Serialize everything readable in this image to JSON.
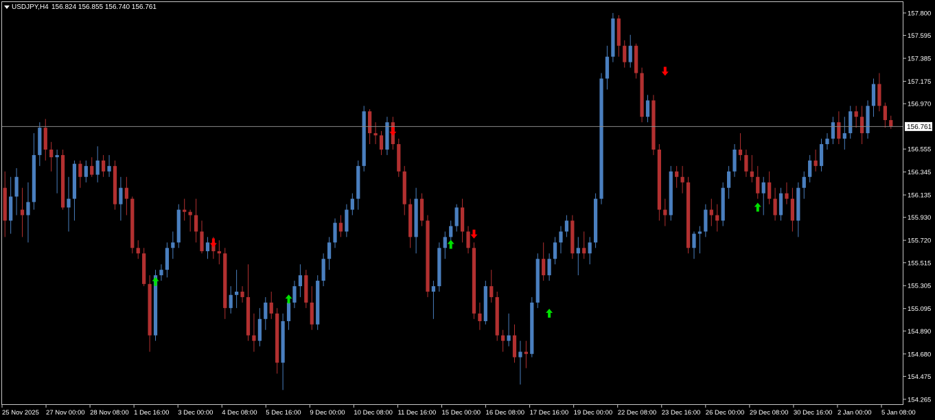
{
  "header": {
    "symbol": "USDJPY,H4",
    "ohlc": "156.824 156.855 156.740 156.761"
  },
  "colors": {
    "background": "#000000",
    "frame": "#c8c8c8",
    "text": "#ffffff",
    "bull": "#4a7fbf",
    "bear": "#b23030",
    "buy_arrow": "#00e000",
    "sell_arrow": "#ff0000",
    "current_price_line": "#8a8a8a",
    "price_label_bg": "#ffffff",
    "price_label_text": "#000000"
  },
  "chart_data": {
    "type": "candlestick",
    "symbol": "USDJPY",
    "timeframe": "H4",
    "ylim": [
      154.22,
      157.9
    ],
    "current_price": "156.761",
    "y_ticks": [
      "157.800",
      "157.595",
      "157.385",
      "157.175",
      "156.970",
      "156.555",
      "156.345",
      "156.135",
      "155.930",
      "155.720",
      "155.515",
      "155.305",
      "155.095",
      "154.890",
      "154.680",
      "154.475",
      "154.265"
    ],
    "x_ticks": [
      "25 Nov 2025",
      "27 Nov 00:00",
      "28 Nov 08:00",
      "1 Dec 16:00",
      "3 Dec 00:00",
      "4 Dec 08:00",
      "5 Dec 16:00",
      "9 Dec 00:00",
      "10 Dec 08:00",
      "11 Dec 16:00",
      "15 Dec 00:00",
      "16 Dec 08:00",
      "17 Dec 16:00",
      "19 Dec 00:00",
      "22 Dec 08:00",
      "23 Dec 16:00",
      "26 Dec 00:00",
      "29 Dec 08:00",
      "30 Dec 16:00",
      "2 Jan 00:00",
      "5 Jan 08:00"
    ],
    "candles": [
      [
        156.2,
        156.35,
        155.75,
        155.9
      ],
      [
        155.9,
        156.3,
        155.78,
        156.12
      ],
      [
        156.12,
        156.38,
        155.95,
        156.3
      ],
      [
        156.0,
        156.2,
        155.75,
        155.95
      ],
      [
        155.95,
        156.25,
        155.7,
        156.07
      ],
      [
        156.07,
        156.7,
        156.0,
        156.5
      ],
      [
        156.5,
        156.8,
        156.4,
        156.75
      ],
      [
        156.75,
        156.83,
        156.45,
        156.55
      ],
      [
        156.55,
        156.62,
        156.35,
        156.48
      ],
      [
        156.48,
        156.55,
        156.15,
        156.5
      ],
      [
        156.5,
        156.55,
        156.0,
        156.02
      ],
      [
        156.02,
        156.3,
        155.8,
        156.1
      ],
      [
        156.1,
        156.45,
        155.9,
        156.42
      ],
      [
        156.42,
        156.45,
        156.2,
        156.3
      ],
      [
        156.3,
        156.45,
        156.25,
        156.4
      ],
      [
        156.4,
        156.48,
        156.3,
        156.32
      ],
      [
        156.32,
        156.58,
        156.25,
        156.45
      ],
      [
        156.45,
        156.5,
        156.3,
        156.35
      ],
      [
        156.35,
        156.5,
        156.3,
        156.4
      ],
      [
        156.4,
        156.45,
        156.0,
        156.05
      ],
      [
        156.05,
        156.3,
        155.9,
        156.2
      ],
      [
        156.2,
        156.3,
        155.95,
        156.1
      ],
      [
        156.1,
        156.12,
        155.6,
        155.65
      ],
      [
        155.65,
        155.72,
        155.55,
        155.6
      ],
      [
        155.6,
        155.65,
        155.3,
        155.32
      ],
      [
        155.32,
        155.4,
        154.7,
        154.85
      ],
      [
        154.85,
        155.45,
        154.8,
        155.4
      ],
      [
        155.4,
        155.5,
        155.35,
        155.45
      ],
      [
        155.45,
        155.7,
        155.38,
        155.65
      ],
      [
        155.65,
        155.8,
        155.55,
        155.7
      ],
      [
        155.7,
        156.05,
        155.65,
        156.0
      ],
      [
        156.0,
        156.1,
        155.9,
        155.98
      ],
      [
        155.98,
        156.0,
        155.8,
        155.95
      ],
      [
        155.95,
        156.1,
        155.7,
        155.8
      ],
      [
        155.8,
        155.9,
        155.6,
        155.62
      ],
      [
        155.62,
        155.75,
        155.55,
        155.7
      ],
      [
        155.7,
        155.75,
        155.55,
        155.62
      ],
      [
        155.62,
        155.72,
        155.5,
        155.6
      ],
      [
        155.6,
        155.65,
        155.0,
        155.1
      ],
      [
        155.1,
        155.3,
        155.05,
        155.22
      ],
      [
        155.22,
        155.45,
        155.1,
        155.25
      ],
      [
        155.25,
        155.3,
        155.15,
        155.2
      ],
      [
        155.2,
        155.5,
        154.8,
        154.85
      ],
      [
        154.85,
        155.05,
        154.7,
        154.8
      ],
      [
        154.8,
        155.1,
        154.75,
        155.0
      ],
      [
        155.0,
        155.2,
        154.9,
        155.15
      ],
      [
        155.15,
        155.25,
        155.0,
        155.05
      ],
      [
        155.05,
        155.1,
        154.5,
        154.6
      ],
      [
        154.6,
        155.05,
        154.35,
        154.98
      ],
      [
        154.98,
        155.2,
        154.9,
        155.15
      ],
      [
        155.15,
        155.35,
        155.1,
        155.3
      ],
      [
        155.3,
        155.5,
        155.2,
        155.4
      ],
      [
        155.4,
        155.45,
        155.1,
        155.15
      ],
      [
        155.15,
        155.3,
        154.9,
        154.95
      ],
      [
        154.95,
        155.4,
        154.9,
        155.35
      ],
      [
        155.35,
        155.6,
        155.3,
        155.55
      ],
      [
        155.55,
        155.75,
        155.45,
        155.7
      ],
      [
        155.7,
        155.92,
        155.65,
        155.88
      ],
      [
        155.88,
        155.95,
        155.75,
        155.8
      ],
      [
        155.8,
        156.05,
        155.75,
        156.0
      ],
      [
        156.0,
        156.15,
        155.95,
        156.1
      ],
      [
        156.1,
        156.45,
        156.0,
        156.4
      ],
      [
        156.4,
        156.95,
        156.35,
        156.9
      ],
      [
        156.9,
        156.92,
        156.6,
        156.7
      ],
      [
        156.7,
        156.8,
        156.6,
        156.68
      ],
      [
        156.68,
        156.72,
        156.5,
        156.55
      ],
      [
        156.55,
        156.85,
        156.5,
        156.8
      ],
      [
        156.8,
        156.85,
        156.55,
        156.6
      ],
      [
        156.6,
        156.65,
        156.3,
        156.35
      ],
      [
        156.35,
        156.4,
        155.95,
        156.05
      ],
      [
        156.05,
        156.1,
        155.65,
        155.75
      ],
      [
        155.75,
        156.2,
        155.6,
        156.1
      ],
      [
        156.1,
        156.15,
        155.85,
        155.9
      ],
      [
        155.9,
        155.95,
        155.2,
        155.25
      ],
      [
        155.25,
        155.35,
        155.0,
        155.3
      ],
      [
        155.3,
        155.7,
        155.25,
        155.65
      ],
      [
        155.65,
        155.8,
        155.55,
        155.75
      ],
      [
        155.75,
        155.9,
        155.7,
        155.85
      ],
      [
        155.85,
        156.05,
        155.8,
        156.02
      ],
      [
        156.02,
        156.1,
        155.7,
        155.8
      ],
      [
        155.8,
        155.85,
        155.6,
        155.65
      ],
      [
        155.65,
        155.7,
        155.0,
        155.05
      ],
      [
        155.05,
        155.15,
        154.9,
        154.98
      ],
      [
        154.98,
        155.35,
        154.95,
        155.3
      ],
      [
        155.3,
        155.45,
        155.15,
        155.2
      ],
      [
        155.2,
        155.25,
        154.8,
        154.85
      ],
      [
        154.85,
        154.9,
        154.7,
        154.8
      ],
      [
        154.8,
        155.05,
        154.75,
        154.85
      ],
      [
        154.85,
        154.95,
        154.6,
        154.65
      ],
      [
        154.65,
        154.8,
        154.4,
        154.7
      ],
      [
        154.7,
        154.8,
        154.55,
        154.68
      ],
      [
        154.68,
        155.2,
        154.65,
        155.15
      ],
      [
        155.15,
        155.6,
        155.1,
        155.55
      ],
      [
        155.55,
        155.7,
        155.35,
        155.4
      ],
      [
        155.4,
        155.6,
        155.35,
        155.55
      ],
      [
        155.55,
        155.75,
        155.5,
        155.7
      ],
      [
        155.7,
        155.85,
        155.6,
        155.8
      ],
      [
        155.8,
        155.95,
        155.75,
        155.9
      ],
      [
        155.9,
        155.95,
        155.55,
        155.6
      ],
      [
        155.6,
        155.75,
        155.4,
        155.65
      ],
      [
        155.65,
        155.8,
        155.55,
        155.6
      ],
      [
        155.6,
        155.75,
        155.5,
        155.7
      ],
      [
        155.7,
        156.15,
        155.65,
        156.1
      ],
      [
        156.1,
        157.25,
        156.05,
        157.2
      ],
      [
        157.2,
        157.5,
        157.1,
        157.4
      ],
      [
        157.4,
        157.8,
        157.35,
        157.75
      ],
      [
        157.75,
        157.78,
        157.4,
        157.5
      ],
      [
        157.5,
        157.55,
        157.3,
        157.35
      ],
      [
        157.35,
        157.6,
        157.3,
        157.5
      ],
      [
        157.5,
        157.52,
        157.2,
        157.25
      ],
      [
        157.25,
        157.3,
        156.8,
        156.85
      ],
      [
        156.85,
        157.05,
        156.8,
        157.0
      ],
      [
        157.0,
        157.05,
        156.5,
        156.55
      ],
      [
        156.55,
        156.6,
        155.9,
        156.0
      ],
      [
        156.0,
        156.1,
        155.85,
        155.95
      ],
      [
        155.95,
        156.4,
        155.9,
        156.35
      ],
      [
        156.35,
        156.4,
        156.2,
        156.3
      ],
      [
        156.3,
        156.4,
        156.15,
        156.25
      ],
      [
        156.25,
        156.3,
        155.6,
        155.65
      ],
      [
        155.65,
        155.8,
        155.55,
        155.78
      ],
      [
        155.78,
        155.85,
        155.6,
        155.8
      ],
      [
        155.8,
        156.05,
        155.75,
        156.0
      ],
      [
        156.0,
        156.1,
        155.85,
        155.95
      ],
      [
        155.95,
        156.05,
        155.8,
        155.9
      ],
      [
        155.9,
        156.25,
        155.85,
        156.2
      ],
      [
        156.2,
        156.4,
        156.1,
        156.35
      ],
      [
        156.35,
        156.6,
        156.3,
        156.55
      ],
      [
        156.55,
        156.7,
        156.45,
        156.5
      ],
      [
        156.5,
        156.55,
        156.3,
        156.35
      ],
      [
        156.35,
        156.5,
        156.25,
        156.3
      ],
      [
        156.3,
        156.4,
        156.1,
        156.15
      ],
      [
        156.15,
        156.3,
        155.95,
        156.25
      ],
      [
        156.25,
        156.35,
        156.05,
        156.1
      ],
      [
        156.1,
        156.2,
        155.9,
        155.95
      ],
      [
        155.95,
        156.2,
        155.9,
        156.15
      ],
      [
        156.15,
        156.25,
        156.05,
        156.1
      ],
      [
        156.1,
        156.2,
        155.8,
        155.9
      ],
      [
        155.9,
        156.25,
        155.75,
        156.2
      ],
      [
        156.2,
        156.35,
        156.1,
        156.3
      ],
      [
        156.3,
        156.5,
        156.25,
        156.45
      ],
      [
        156.45,
        156.55,
        156.35,
        156.4
      ],
      [
        156.4,
        156.65,
        156.35,
        156.6
      ],
      [
        156.6,
        156.7,
        156.55,
        156.65
      ],
      [
        156.65,
        156.85,
        156.6,
        156.8
      ],
      [
        156.8,
        156.9,
        156.6,
        156.65
      ],
      [
        156.65,
        156.85,
        156.55,
        156.7
      ],
      [
        156.7,
        156.95,
        156.65,
        156.9
      ],
      [
        156.9,
        156.95,
        156.75,
        156.85
      ],
      [
        156.85,
        156.95,
        156.6,
        156.7
      ],
      [
        156.7,
        157.0,
        156.65,
        156.95
      ],
      [
        156.95,
        157.2,
        156.85,
        157.15
      ],
      [
        157.15,
        157.25,
        156.9,
        156.95
      ],
      [
        156.95,
        156.98,
        156.75,
        156.82
      ],
      [
        156.82,
        156.86,
        156.74,
        156.76
      ]
    ],
    "signals": [
      {
        "type": "buy",
        "candle": 26,
        "price": 155.34
      },
      {
        "type": "sell",
        "candle": 36,
        "price": 155.7
      },
      {
        "type": "buy",
        "candle": 49,
        "price": 155.18
      },
      {
        "type": "sell",
        "candle": 67,
        "price": 156.72
      },
      {
        "type": "buy",
        "candle": 77,
        "price": 155.68
      },
      {
        "type": "sell",
        "candle": 81,
        "price": 155.78
      },
      {
        "type": "buy",
        "candle": 94,
        "price": 155.05
      },
      {
        "type": "sell",
        "candle": 114,
        "price": 157.27
      },
      {
        "type": "buy",
        "candle": 130,
        "price": 156.02
      }
    ]
  }
}
